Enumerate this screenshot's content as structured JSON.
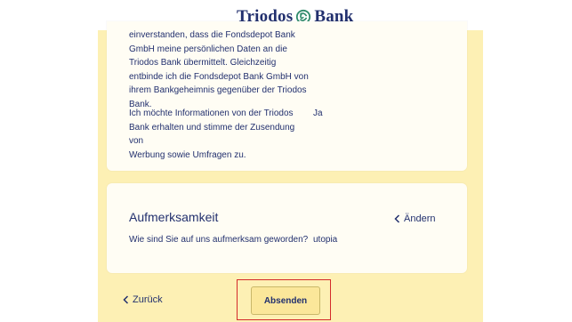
{
  "brand": {
    "left": "Triodos",
    "right": "Bank"
  },
  "consent": {
    "lines1": [
      "einverstanden, dass die Fondsdepot Bank",
      "GmbH meine persönlichen Daten an die",
      "Triodos Bank übermittelt. Gleichzeitig",
      "entbinde ich die Fondsdepot Bank GmbH von",
      "ihrem Bankgeheimnis gegenüber der Triodos",
      "Bank."
    ],
    "lines2": [
      "Ich möchte Informationen von der Triodos",
      "Bank erhalten und stimme der Zusendung von",
      "Werbung sowie Umfragen zu."
    ],
    "value": "Ja"
  },
  "attention": {
    "title": "Aufmerksamkeit",
    "edit_label": "Ändern",
    "question": "Wie sind Sie auf uns aufmerksam geworden?",
    "answer": "utopia"
  },
  "footer": {
    "back_label": "Zurück",
    "submit_label": "Absenden"
  },
  "colors": {
    "brand_navy": "#22306e",
    "content_background": "#fdf0b4",
    "button_background": "#fbe79a",
    "highlight": "#d42b2b"
  },
  "icons": {
    "brand": "triodos-emblem-icon",
    "edit": "chevron-left-icon",
    "back": "chevron-left-icon"
  }
}
